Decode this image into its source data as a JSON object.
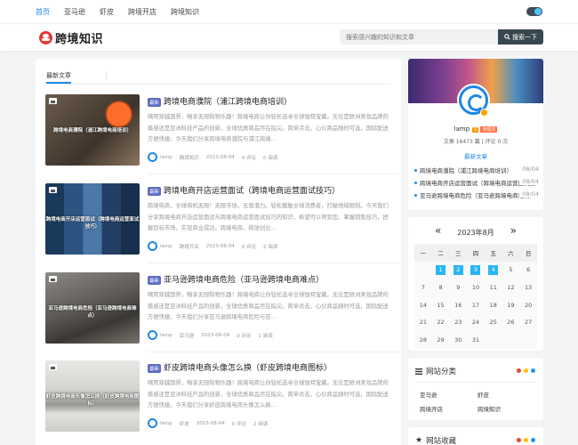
{
  "topnav": {
    "items": [
      "首页",
      "亚马逊",
      "虾皮",
      "跨境开店",
      "跨境知识"
    ],
    "active_index": 0
  },
  "header": {
    "logo_text": "跨境知识",
    "search_placeholder": "搜索感兴趣的知识和文章",
    "search_button": "搜索一下"
  },
  "main": {
    "tab_label": "最新文章",
    "articles": [
      {
        "thumb_label": "跨境电商濮院（浦江跨境电商培训）",
        "badge": "最新",
        "title": "跨境电商濮院（浦江跨境电商培训）",
        "excerpt": "嘀哥穿越国界，畅享无限购物乐趣！跨境电商让你轻松选寻全球独特宝藏。无论是欧洲美妆品牌的蔡感还是亚洲科技产品的创新，全球优质商品尽在指尖。简单点击，心仪商品随时可选，国际配送方便快捷。今天我们分享跨境电商濮院与浦江跨境...",
        "author": "lamp",
        "category": "跨境知识",
        "date": "2023-08-04",
        "comments": "0 评论",
        "reads": "0 阅读"
      },
      {
        "thumb_label": "跨境电商开店运营面试（跨境电商运营面试技巧）",
        "badge": "最新",
        "title": "跨境电商开店运营面试（跨境电商运营面试技巧）",
        "excerpt": "跨境电商，全球商机无限！无限市场，无限潜力。轻松搬触全球消费者，打破地域限制。今天我们分享跨境电商开店运营面试与跨境电商运营面试技巧的知识，希望可以帮到您。掌握销售技巧，把握目标市场，实现商业成功。跨境电商，释放创业...",
        "author": "lamp",
        "category": "跨境开店",
        "date": "2023-08-04",
        "comments": "0 评论",
        "reads": "2 阅读"
      },
      {
        "thumb_label": "亚马逊跨境电商危险（亚马逊跨境电商难点）",
        "badge": "最新",
        "title": "亚马逊跨境电商危险（亚马逊跨境电商难点）",
        "excerpt": "嘀哥穿越国界，畅享无限购物乐趣！跨境电商让你轻松选寻全球独特宝藏。无论是欧洲美妆品牌的蔡感还是亚洲科技产品的创新，全球优质商品尽在指尖。简单点击，心仪商品随时可选，国际配送方便快捷。今天我们分享亚马逊跨境电商危险与亚...",
        "author": "lamp",
        "category": "亚马逊",
        "date": "2023-08-04",
        "comments": "0 评论",
        "reads": "1 阅读"
      },
      {
        "thumb_label": "虾皮跨境电商头像怎么换（虾皮跨境电商图标）",
        "badge": "最新",
        "title": "虾皮跨境电商头像怎么换（虾皮跨境电商图标）",
        "excerpt": "嘀哥穿越国界，畅享无限购物乐趣！跨境电商让你轻松选寻全球独特宝藏。无论是欧洲美妆品牌的蔡感还是亚洲科技产品的创新，全球优质商品尽在指尖。简单点击，心仪商品随时可选，国际配送方便快捷。今天我们分享虾皮跨境电商头像怎么换...",
        "author": "lamp",
        "category": "虾皮",
        "date": "2023-08-04",
        "comments": "0 评论",
        "reads": "2 阅读"
      }
    ]
  },
  "profile": {
    "name": "lamp",
    "level": "V",
    "role": "管理员",
    "stats": "文章 16473 篇 | 评论 0 次",
    "recent_label": "最新文章",
    "recent": [
      {
        "title": "跨境电商濮院（浦江跨境电商培训）",
        "date": "08/04"
      },
      {
        "title": "跨境电商开店运营面试（跨境电商运营面试技巧）",
        "date": "08/04"
      },
      {
        "title": "亚马逊跨境电商危险（亚马逊跨境电商难点）",
        "date": "08/04"
      }
    ]
  },
  "calendar": {
    "title": "2023年8月",
    "prev": "«",
    "next": "»",
    "weekdays": [
      "一",
      "二",
      "三",
      "四",
      "五",
      "六",
      "日"
    ],
    "days": [
      "",
      "1",
      "2",
      "3",
      "4",
      "5",
      "6",
      "7",
      "8",
      "9",
      "10",
      "11",
      "12",
      "13",
      "14",
      "15",
      "16",
      "17",
      "18",
      "19",
      "20",
      "21",
      "22",
      "23",
      "24",
      "25",
      "26",
      "27",
      "28",
      "29",
      "30",
      "31",
      "",
      "",
      ""
    ],
    "highlighted": [
      "1",
      "2",
      "3",
      "4"
    ]
  },
  "categories": {
    "title": "网站分类",
    "items": [
      "亚马逊",
      "虾皮",
      "跨境开店",
      "跨境知识"
    ]
  },
  "favorites": {
    "title": "网站收藏"
  },
  "colors": {
    "accent": "#1e88e5",
    "dot_red": "#f44336",
    "dot_yellow": "#ffc107",
    "dot_blue": "#2196f3"
  }
}
